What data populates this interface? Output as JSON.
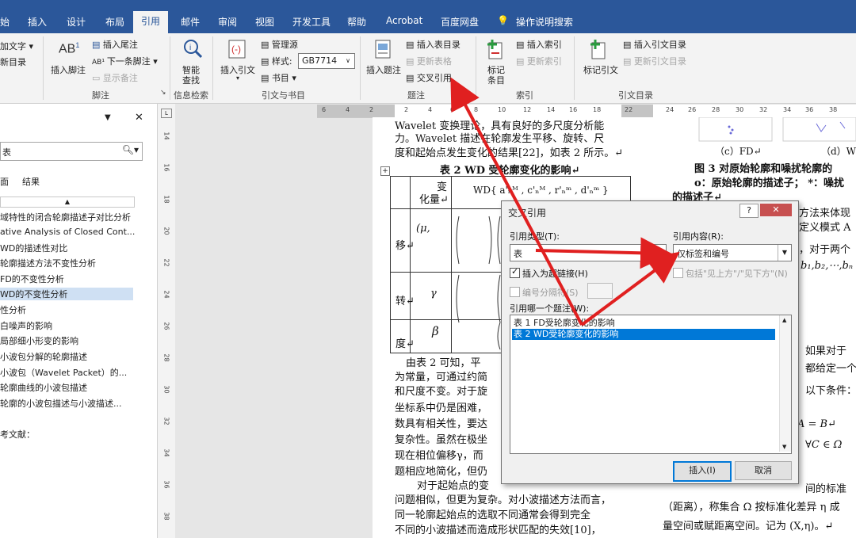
{
  "tabs": [
    "始",
    "插入",
    "设计",
    "布局",
    "引用",
    "邮件",
    "审阅",
    "视图",
    "开发工具",
    "帮助",
    "Acrobat",
    "百度网盘",
    "操作说明搜索"
  ],
  "active_tab": "引用",
  "ribbon": {
    "add_text": "加文字 ▾",
    "update_toc": "新目录",
    "insert_footnote": "插入脚注",
    "insert_endnote": "插入尾注",
    "next_footnote": "下一条脚注 ▾",
    "show_notes": "显示备注",
    "group_footnotes": "脚注",
    "smart_lookup": "智能\n查找",
    "smart_lookup_1": "智能",
    "smart_lookup_2": "查找",
    "group_insights": "信息检索",
    "insert_citation": "插入引文",
    "manage_sources": "管理源",
    "style_label": "样式:",
    "style_value": "GB7714",
    "bibliography": "书目 ▾",
    "group_citations": "引文与书目",
    "insert_caption": "插入题注",
    "insert_table_of_figures": "插入表目录",
    "update_table": "更新表格",
    "cross_reference": "交叉引用",
    "group_captions": "题注",
    "mark_entry_1": "标记",
    "mark_entry_2": "条目",
    "insert_index": "插入索引",
    "update_index": "更新索引",
    "group_index": "索引",
    "mark_citation": "标记引文",
    "insert_table_of_authorities": "插入引文目录",
    "update_table_of_authorities": "更新引文目录",
    "group_toa": "引文目录"
  },
  "nav": {
    "search_placeholder": "表",
    "tab_pages": "面",
    "tab_results": "结果",
    "items": [
      "域特性的闭合轮廓描述子对比分析",
      "ative Analysis of Closed Cont...",
      "WD的描述性对比",
      "轮廓描述方法不变性分析",
      "FD的不变性分析",
      "WD的不变性分析",
      "性分析",
      "白噪声的影响",
      "局部细小形变的影响",
      "小波包分解的轮廓描述",
      "小波包（Wavelet Packet）的...",
      "轮廓曲线的小波包描述",
      "轮廓的小波包描述与小波描述...",
      "考文献："
    ],
    "selected_index": 5
  },
  "ruler_ticks": [
    "6",
    "4",
    "2",
    "2",
    "4",
    "6",
    "8",
    "10",
    "12",
    "14",
    "16",
    "18",
    "22",
    "24",
    "26",
    "28",
    "30",
    "32",
    "34",
    "36",
    "38",
    "40"
  ],
  "vruler_ticks": [
    "14",
    "16",
    "18",
    "20",
    "22",
    "24",
    "26",
    "28",
    "30",
    "32",
    "34",
    "36",
    "38"
  ],
  "document": {
    "line1": "Wavelet 变换理论，具有良好的多尺度分析能",
    "line2": "力。Wavelet 描述在轮廓发生平移、旋转、尺",
    "line3": "度和起始点发生变化的结果[22]，如表 2 所示。↵",
    "table_caption": "表 2 WD 受轮廓变化的影响↵",
    "col_header_1": "变",
    "col_header_2": "化量↵",
    "col_header_wd": "WD{ a'ₙᴹ , c'ₙᴹ , r'ₙᵐ , d'ₙᵐ }",
    "row_labels": [
      "移↵",
      "转↵",
      "度↵"
    ],
    "row_symbols": [
      "(μ,",
      "γ",
      "β"
    ],
    "para2_1": "由表 2 可知，平",
    "para2_2": "为常量，可通过约简",
    "para2_3": "和尺度不变。对于旋",
    "para2_4": "坐标系中仍是困难，",
    "para2_5": "数具有相关性，要达",
    "para2_6": "复杂性。虽然在极坐",
    "para2_7": "现在相位偏移γ，而",
    "para2_8": "题相应地简化，但仍",
    "para3_1": "对于起始点的变",
    "para3_2": "问题相似，但更为复杂。对小波描述方法而言，",
    "para3_3": "同一轮廓起始点的选取不同通常会得到完全",
    "para3_4": "不同的小波描述而造成形状匹配的失效[10]，",
    "right_cap_c": "（c）FD↵",
    "right_cap_d": "（d）W",
    "fig3_line1": "图 3   对原始轮廓和噪扰轮廓的",
    "fig3_line2": "o：原始轮廓的描述子；  *：噪扰",
    "fig3_line3": "的描述子↵",
    "right_t1": "方法来体现",
    "right_t2": "定义模式 A",
    "right_t3": "，对于两个",
    "right_t4": "b₁,b₂,⋯,bₙ",
    "right_t5": "如果对于",
    "right_t6": "都给定一个",
    "right_t7": "以下条件：↵",
    "right_t8": "A = B↵",
    "right_t9": "∀C ∈ Ω",
    "right_t10": "间的标准",
    "right_t11": "（距离），称集合 Ω 按标准化差异 η 成",
    "right_t12": "量空间或赋距离空间。记为 (X,η)。↵"
  },
  "dialog": {
    "title": "交叉引用",
    "ref_type_label": "引用类型(T):",
    "ref_type_value": "表",
    "ref_content_label": "引用内容(R):",
    "ref_content_value": "仅标签和编号",
    "insert_hyperlink": "插入为超链接(H)",
    "include_above_below": "包括\"见上方\"/\"见下方\"(N)",
    "separate_numbers": "编号分隔符(S)",
    "which_caption_label": "引用哪一个题注(W):",
    "captions": [
      "表 1 FD受轮廓变化的影响",
      "表 2 WD受轮廓变化的影响"
    ],
    "selected_caption": 1,
    "insert_button": "插入(I)",
    "cancel_button": "取消",
    "help_button": "?",
    "close_button": "✕"
  },
  "colors": {
    "ribbon_blue": "#2b579a",
    "arrow_red": "#e02020",
    "selection_blue": "#0078d7"
  }
}
